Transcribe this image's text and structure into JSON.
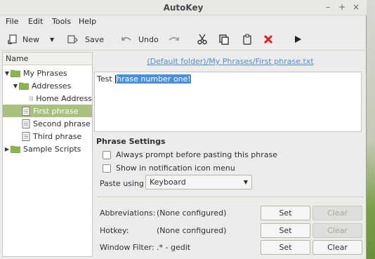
{
  "window": {
    "title": "AutoKey"
  },
  "menu": [
    "File",
    "Edit",
    "Tools",
    "Help"
  ],
  "toolbar": {
    "new_label": "New",
    "save_label": "Save",
    "undo_label": "Undo"
  },
  "sidebar": {
    "column_header": "Name",
    "items": [
      {
        "label": "My Phrases",
        "icon": "folder-icon"
      },
      {
        "label": "Addresses",
        "icon": "folder-icon"
      },
      {
        "label": "Home Address",
        "icon": "document-icon"
      },
      {
        "label": "First phrase",
        "icon": "document-icon"
      },
      {
        "label": "Second phrase",
        "icon": "document-icon"
      },
      {
        "label": "Third phrase",
        "icon": "document-icon"
      },
      {
        "label": "Sample Scripts",
        "icon": "folder-icon"
      }
    ]
  },
  "editor": {
    "path": "(Default folder)/My Phrases/First phrase.txt",
    "text_before": "Test ",
    "selected_text": "hrase number one!"
  },
  "phrase_settings": {
    "title": "Phrase Settings",
    "always_prompt_label": "Always prompt before pasting this phrase",
    "show_notification_label": "Show in notification icon menu",
    "paste_using_label": "Paste using",
    "paste_using_value": "Keyboard"
  },
  "fields": {
    "abbreviations_label": "Abbreviations:",
    "abbreviations_value": "(None configured)",
    "hotkey_label": "Hotkey:",
    "hotkey_value": "(None configured)",
    "window_filter_label": "Window Filter:",
    "window_filter_value": ".* - gedit",
    "set_label": "Set",
    "clear_label": "Clear"
  }
}
